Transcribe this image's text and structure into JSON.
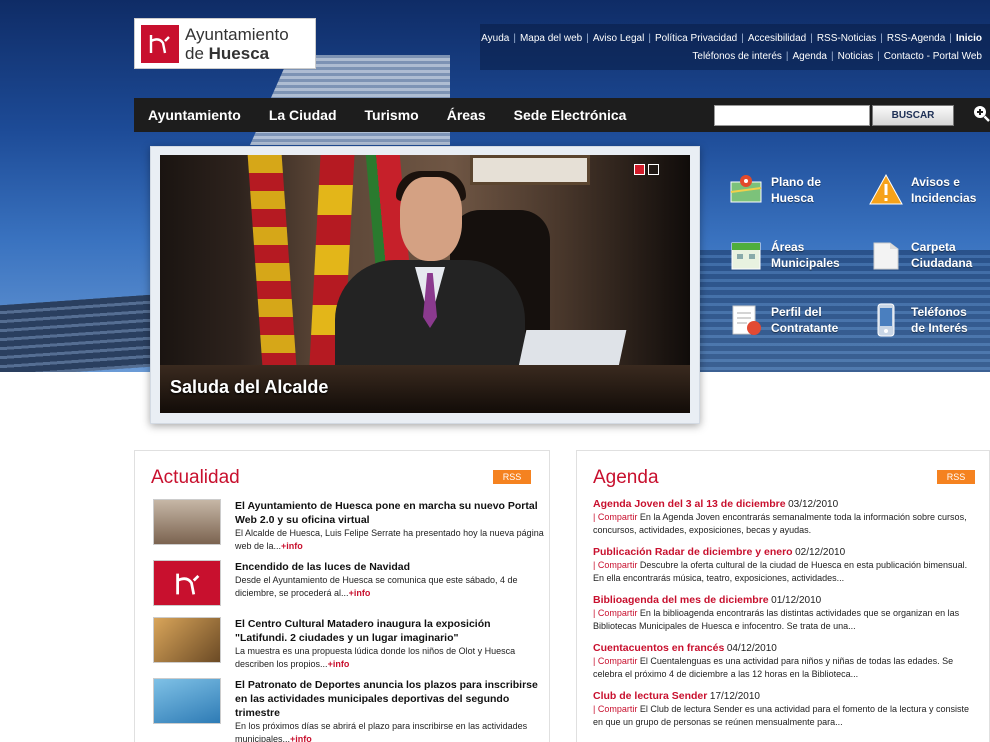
{
  "logo": {
    "line1": "Ayuntamiento",
    "line2_prefix": "de ",
    "line2_bold": "Huesca"
  },
  "utility": {
    "row1": [
      "Ayuda",
      "Mapa del web",
      "Aviso Legal",
      "Política Privacidad",
      "Accesibilidad",
      "RSS-Noticias",
      "RSS-Agenda",
      "Inicio"
    ],
    "row2": [
      "Teléfonos de interés",
      "Agenda",
      "Noticias",
      "Contacto - Portal Web"
    ]
  },
  "nav": {
    "items": [
      "Ayuntamiento",
      "La Ciudad",
      "Turismo",
      "Áreas",
      "Sede Electrónica"
    ],
    "search_value": "",
    "search_button": "BUSCAR"
  },
  "feature": {
    "caption": "Saluda del Alcalde"
  },
  "quick_links": [
    {
      "label": "Plano de\nHuesca",
      "icon": "map-icon"
    },
    {
      "label": "Avisos e\nIncidencias",
      "icon": "warning-icon"
    },
    {
      "label": "Áreas\nMunicipales",
      "icon": "building-icon"
    },
    {
      "label": "Carpeta\nCiudadana",
      "icon": "folder-icon"
    },
    {
      "label": "Perfil del\nContratante",
      "icon": "contract-icon"
    },
    {
      "label": "Teléfonos\nde Interés",
      "icon": "phone-icon"
    }
  ],
  "actualidad": {
    "title": "Actualidad",
    "rss": "RSS",
    "items": [
      {
        "title": "El Ayuntamiento de Huesca pone en marcha su nuevo Portal Web 2.0 y su oficina virtual",
        "text": "El Alcalde de Huesca, Luis Felipe Serrate ha presentado hoy la nueva página web de la...",
        "more": "+info"
      },
      {
        "title": "Encendido de las luces de Navidad",
        "text": "Desde el Ayuntamiento de Huesca se comunica que este sábado, 4 de diciembre, se procederá al...",
        "more": "+info"
      },
      {
        "title": "El Centro Cultural Matadero inaugura la exposición \"Latifundi. 2 ciudades y un lugar imaginario\"",
        "text": "La muestra es una propuesta lúdica donde los niños de Olot y Huesca describen los propios...",
        "more": "+info"
      },
      {
        "title": "El Patronato de Deportes anuncia los plazos para inscribirse en las actividades municipales deportivas del segundo trimestre",
        "text": "En los próximos días se abrirá el plazo para inscribirse en las actividades municipales...",
        "more": "+info"
      }
    ]
  },
  "agenda": {
    "title": "Agenda",
    "rss": "RSS",
    "items": [
      {
        "title": "Agenda Joven del 3 al 13 de diciembre",
        "date": "03/12/2010",
        "share": "| Compartir",
        "text": "En la Agenda Joven encontrarás semanalmente toda la información sobre cursos, concursos, actividades, exposiciones, becas y ayudas."
      },
      {
        "title": "Publicación Radar de diciembre y enero",
        "date": "02/12/2010",
        "share": "| Compartir",
        "text": "Descubre la oferta cultural de la ciudad de Huesca en esta publicación bimensual. En ella encontrarás música, teatro, exposiciones, actividades..."
      },
      {
        "title": "Biblioagenda del mes de diciembre",
        "date": "01/12/2010",
        "share": "| Compartir",
        "text": "En la biblioagenda encontrarás las distintas actividades que se organizan en las Bibliotecas Municipales de Huesca e infocentro. Se trata de una..."
      },
      {
        "title": "Cuentacuentos en francés",
        "date": "04/12/2010",
        "share": "| Compartir",
        "text": "El Cuentalenguas es una actividad para niños y niñas de todas las edades. Se celebra el próximo 4 de diciembre a las 12 horas en la Biblioteca..."
      },
      {
        "title": "Club de lectura Sender",
        "date": "17/12/2010",
        "share": "| Compartir",
        "text": "El Club de lectura Sender es una actividad para el fomento de la lectura y consiste en que un grupo de personas se reúnen mensualmente para..."
      }
    ]
  }
}
